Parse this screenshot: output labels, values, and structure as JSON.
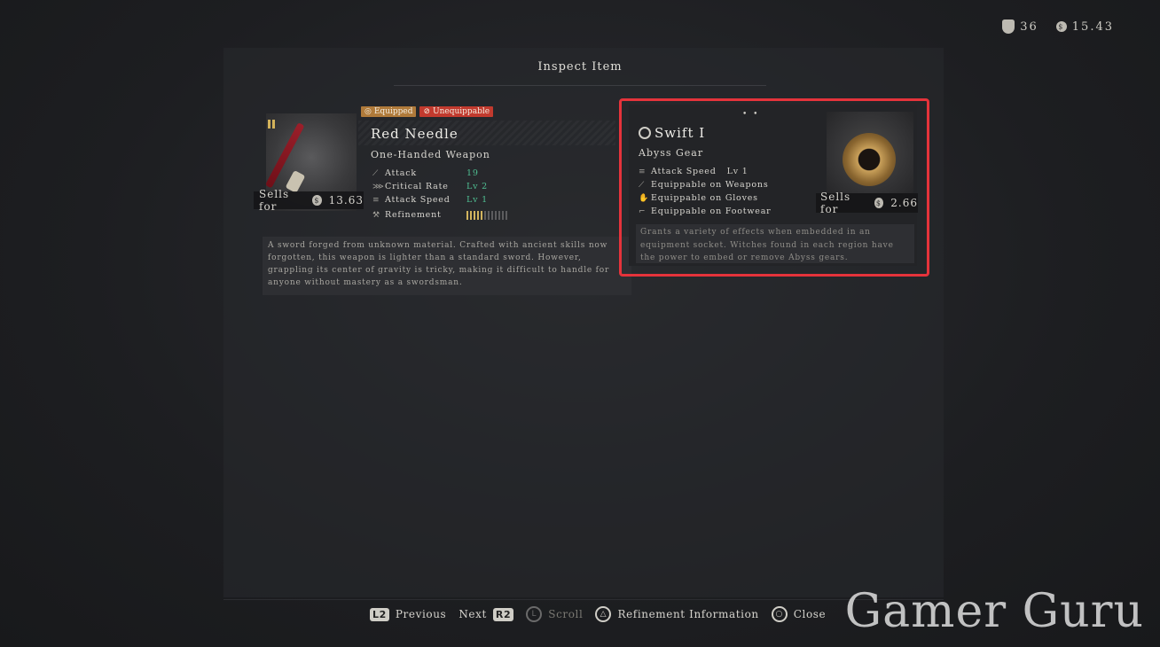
{
  "currency": {
    "insight": "36",
    "coins": "15.43"
  },
  "title": "Inspect Item",
  "left_item": {
    "badge_equipped": "Equipped",
    "badge_unequippable": "Unequippable",
    "name": "Red Needle",
    "type": "One-Handed Weapon",
    "sells_label": "Sells for",
    "sells_value": "13.63",
    "stats": [
      {
        "icon": "sword-icon",
        "label": "Attack",
        "value": "19"
      },
      {
        "icon": "critical-icon",
        "label": "Critical Rate",
        "value": "Lv 2"
      },
      {
        "icon": "speed-icon",
        "label": "Attack Speed",
        "value": "Lv 1"
      }
    ],
    "refinement_label": "Refinement",
    "refinement_level": 0.4,
    "description": "A sword forged from unknown material. Crafted with ancient skills now forgotten, this weapon is lighter than a standard sword. However, grappling its center of gravity is tricky, making it difficult to handle for anyone without mastery as a swordsman."
  },
  "right_item": {
    "name": "Swift I",
    "type": "Abyss Gear",
    "sells_label": "Sells for",
    "sells_value": "2.66",
    "stats": [
      {
        "label": "Attack Speed",
        "value": "Lv 1"
      },
      {
        "label": "Equippable on Weapons",
        "value": ""
      },
      {
        "label": "Equippable on Gloves",
        "value": ""
      },
      {
        "label": "Equippable on Footwear",
        "value": ""
      }
    ],
    "description": "Grants a variety of effects when embedded in an equipment socket. Witches found in each region have the power to embed or remove Abyss gears."
  },
  "footer": {
    "l2": "L2",
    "previous": "Previous",
    "next": "Next",
    "r2": "R2",
    "l": "L",
    "scroll": "Scroll",
    "refinement_info": "Refinement Information",
    "close": "Close"
  },
  "watermark": "Gamer Guru",
  "colors": {
    "highlight": "#e5333b",
    "stat_green": "#4fbf92",
    "equipped": "#b07a3a",
    "unequippable": "#c23a2e"
  }
}
